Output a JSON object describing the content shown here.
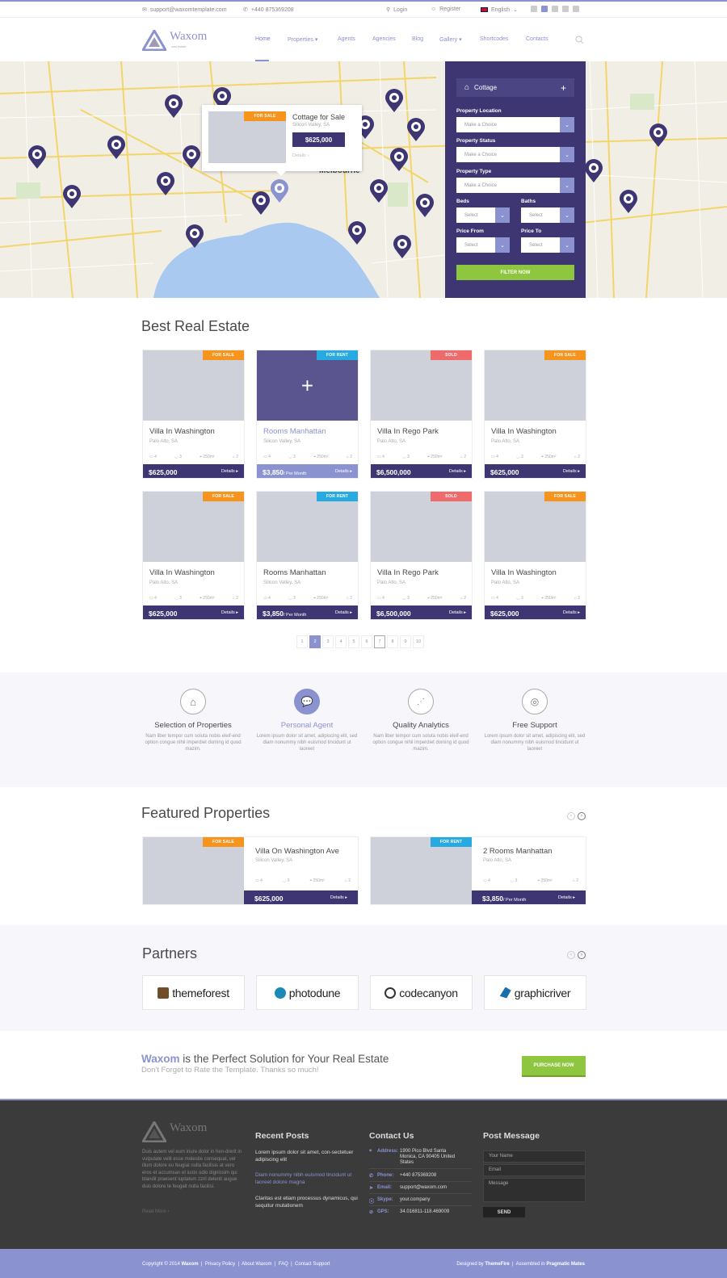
{
  "topbar": {
    "email": "support@waxomtemplate.com",
    "phone": "+440 875369208",
    "login": "Login",
    "register": "Register",
    "language": "English"
  },
  "header": {
    "logo_name": "Waxom",
    "logo_sub": "real estate",
    "nav": [
      "Home",
      "Properties",
      "Agents",
      "Agencies",
      "Blog",
      "Gallery",
      "Shortcodes",
      "Contacts"
    ]
  },
  "map_popup": {
    "badge": "FOR SALE",
    "title": "Cottage for Sale",
    "location": "Silicon Valley, SA",
    "price": "$625,000",
    "details": "Details"
  },
  "map_labels": {
    "city": "Melbourne"
  },
  "filter": {
    "type": "Cottage",
    "location_label": "Property Location",
    "location_value": "Make a Choice",
    "status_label": "Property Status",
    "status_value": "Make a Choice",
    "type_label": "Property Type",
    "type_value": "Make a Choice",
    "beds_label": "Beds",
    "beds_value": "Select",
    "baths_label": "Baths",
    "baths_value": "Select",
    "price_from_label": "Price From",
    "price_from_value": "Select",
    "price_to_label": "Price To",
    "price_to_value": "Select",
    "button": "FILTER NOW"
  },
  "best": {
    "title": "Best Real Estate",
    "cards": [
      {
        "badge": "FOR SALE",
        "title": "Villa In Washington",
        "loc": "Palo Alto, SA",
        "price": "$625,000",
        "per": "",
        "beds": "4",
        "baths": "3",
        "area": "250m²",
        "garage": "2"
      },
      {
        "badge": "FOR RENT",
        "title": "Rooms Manhattan",
        "loc": "Silicon Valley, SA",
        "price": "$3,850",
        "per": "/ Per Month",
        "beds": "4",
        "baths": "3",
        "area": "250m²",
        "garage": "2"
      },
      {
        "badge": "SOLD",
        "title": "Villa In Rego Park",
        "loc": "Palo Alto, SA",
        "price": "$6,500,000",
        "per": "",
        "beds": "4",
        "baths": "3",
        "area": "250m²",
        "garage": "2"
      },
      {
        "badge": "FOR SALE",
        "title": "Villa In Washington",
        "loc": "Palo Alto, SA",
        "price": "$625,000",
        "per": "",
        "beds": "4",
        "baths": "3",
        "area": "250m²",
        "garage": "2"
      },
      {
        "badge": "FOR SALE",
        "title": "Villa In Washington",
        "loc": "Palo Alto, SA",
        "price": "$625,000",
        "per": "",
        "beds": "4",
        "baths": "3",
        "area": "250m²",
        "garage": "2"
      },
      {
        "badge": "FOR RENT",
        "title": "Rooms Manhattan",
        "loc": "Silicon Valley, SA",
        "price": "$3,850",
        "per": "/ Per Month",
        "beds": "4",
        "baths": "3",
        "area": "250m²",
        "garage": "2"
      },
      {
        "badge": "SOLD",
        "title": "Villa In Rego Park",
        "loc": "Palo Alto, SA",
        "price": "$6,500,000",
        "per": "",
        "beds": "4",
        "baths": "3",
        "area": "250m²",
        "garage": "2"
      },
      {
        "badge": "FOR SALE",
        "title": "Villa In Washington",
        "loc": "Palo Alto, SA",
        "price": "$625,000",
        "per": "",
        "beds": "4",
        "baths": "3",
        "area": "250m²",
        "garage": "2"
      }
    ],
    "details": "Details",
    "pages": [
      "1",
      "2",
      "3",
      "4",
      "5",
      "6",
      "7",
      "8",
      "9",
      "10"
    ]
  },
  "features": [
    {
      "title": "Selection of Properties",
      "text": "Nam liber tempor cum soluta nobis eleif-end option congue nihil imperdiet doming id quod mazim."
    },
    {
      "title": "Personal Agent",
      "text": "Lorem ipsum dolor sit amet, adipiscing elit, sed diam nonummy nibh euismod tincidunt ut laoreet"
    },
    {
      "title": "Quality Analytics",
      "text": "Nam liber tempor cum soluta nobis eleif-end option congue nihil imperdiet doming id quod mazim."
    },
    {
      "title": "Free Support",
      "text": "Lorem ipsum dolor sit amet, adipiscing elit, sed diam nonummy nibh euismod tincidunt ut laoreet"
    }
  ],
  "featured": {
    "title": "Featured Properties",
    "cards": [
      {
        "badge": "FOR SALE",
        "title": "Villa On Washington Ave",
        "loc": "Silicon Valley, SA",
        "price": "$625,000",
        "per": "",
        "beds": "4",
        "baths": "3",
        "area": "250m²",
        "garage": "2"
      },
      {
        "badge": "FOR RENT",
        "title": "2 Rooms Manhattan",
        "loc": "Palo Alto, SA",
        "price": "$3,850",
        "per": "/ Per Month",
        "beds": "4",
        "baths": "3",
        "area": "250m²",
        "garage": "2"
      }
    ]
  },
  "partners": {
    "title": "Partners",
    "logos": [
      "themeforest",
      "photodune",
      "codecanyon",
      "graphicriver"
    ]
  },
  "cta": {
    "brand": "Waxom",
    "headline": " is the Perfect Solution for Your Real Estate",
    "sub": "Don't Forget to Rate the Template. Thanks so much!",
    "button": "PURCHASE NOW"
  },
  "footer": {
    "about": "Duis autem vel eum iriure dolor in hen-drerit in vulputate velit esse molestie consequat, vel illum dolore eu feugiat nulla facilisis at vero eros et accumsan et iusto odio dignissim qui blandit praesent luptatum zzril delenit augue duis dolore te feugait nulla facilisi.",
    "read_more": "Read More",
    "posts_title": "Recent Posts",
    "posts": [
      "Lorem ipsum dolor sit amet, con-sectetuer adipiscing elit",
      "Diam nonummy nibh euismod tincidunt ut laoreet dolore magna",
      "Claritas est etiam processus dynamicus, qui sequitur mutationem"
    ],
    "contact_title": "Contact Us",
    "contact": [
      {
        "k": "Address:",
        "v": "1900 Pico Blvd Santa Monica, CA 90405 United States"
      },
      {
        "k": "Phone:",
        "v": "+440 875369208"
      },
      {
        "k": "Email:",
        "v": "support@waxom.com"
      },
      {
        "k": "Skype:",
        "v": "your.company"
      },
      {
        "k": "GPS:",
        "v": "34.016811-118.469009"
      }
    ],
    "message_title": "Post Message",
    "name_ph": "Your Name",
    "email_ph": "Email",
    "message_ph": "Message",
    "send": "SEND"
  },
  "bottom": {
    "copyright": "Copyright © 2014",
    "brand": "Waxom",
    "links": [
      "Privacy Policy",
      "About Waxom",
      "FAQ",
      "Contact Support"
    ],
    "designed": "Designed by",
    "designer": "ThemeFire",
    "assembled": "Assembled in",
    "assembler": "Pragmatic Mates"
  }
}
